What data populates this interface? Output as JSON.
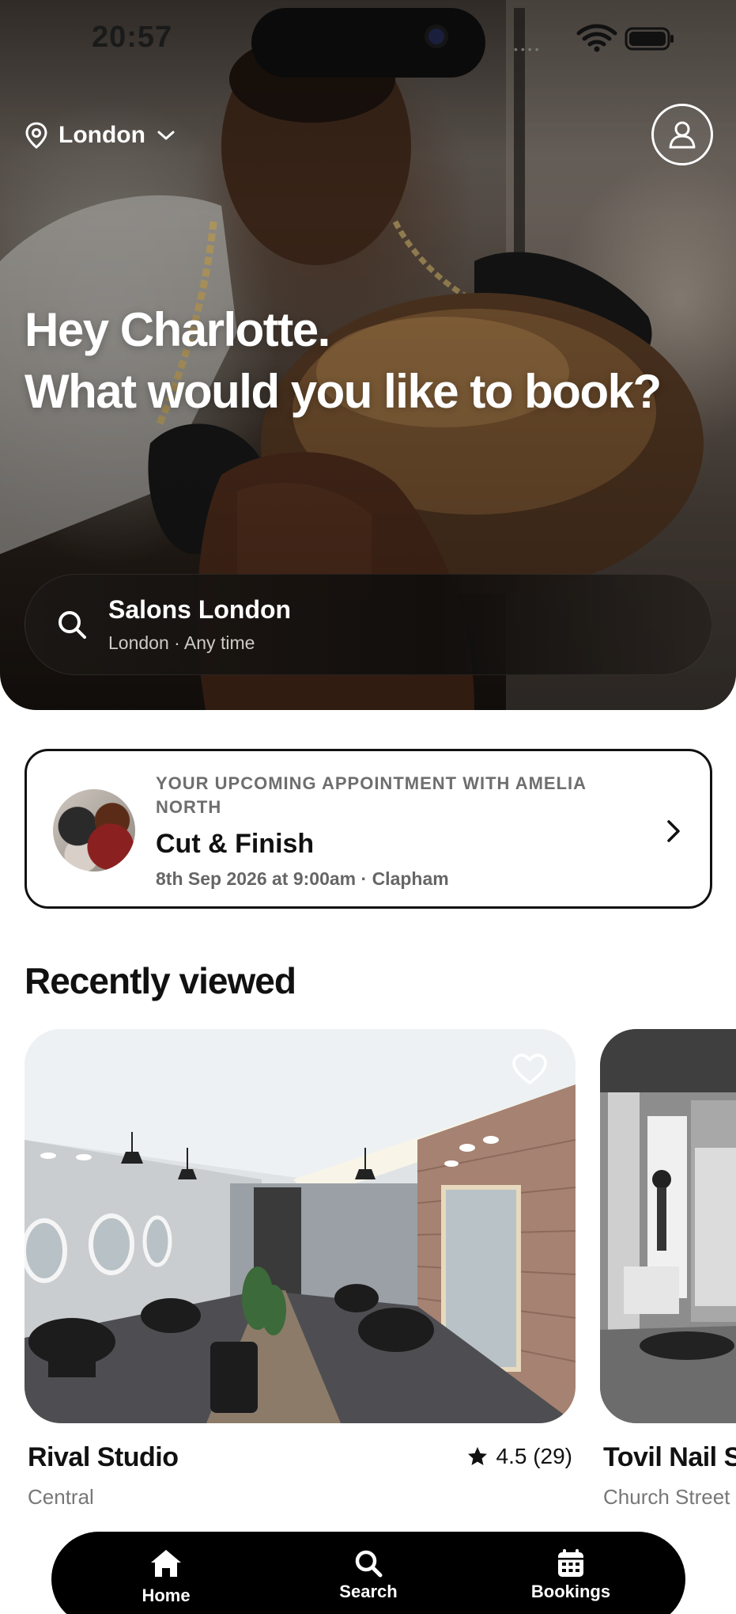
{
  "status_bar": {
    "time": "20:57"
  },
  "header": {
    "location": "London"
  },
  "hero": {
    "greeting_line1": "Hey Charlotte.",
    "greeting_line2": "What would you like to book?"
  },
  "search": {
    "title": "Salons London",
    "subtitle": "London · Any time"
  },
  "appointment": {
    "kicker": "YOUR UPCOMING APPOINTMENT WITH AMELIA NORTH",
    "service": "Cut & Finish",
    "details": "8th Sep 2026 at 9:00am · Clapham"
  },
  "recently_viewed": {
    "title": "Recently viewed",
    "venues": [
      {
        "name": "Rival Studio",
        "area": "Central",
        "rating": "4.5 (29)"
      },
      {
        "name": "Tovil Nail S",
        "area": "Church Street"
      }
    ]
  },
  "tab_bar": {
    "tabs": [
      {
        "label": "Home",
        "icon": "home-icon",
        "active": true
      },
      {
        "label": "Search",
        "icon": "search-icon",
        "active": false
      },
      {
        "label": "Bookings",
        "icon": "calendar-icon",
        "active": false
      }
    ]
  },
  "colors": {
    "text": "#111111",
    "muted": "#6e6e6e",
    "tab_bar": "#000000",
    "background": "#ffffff"
  }
}
